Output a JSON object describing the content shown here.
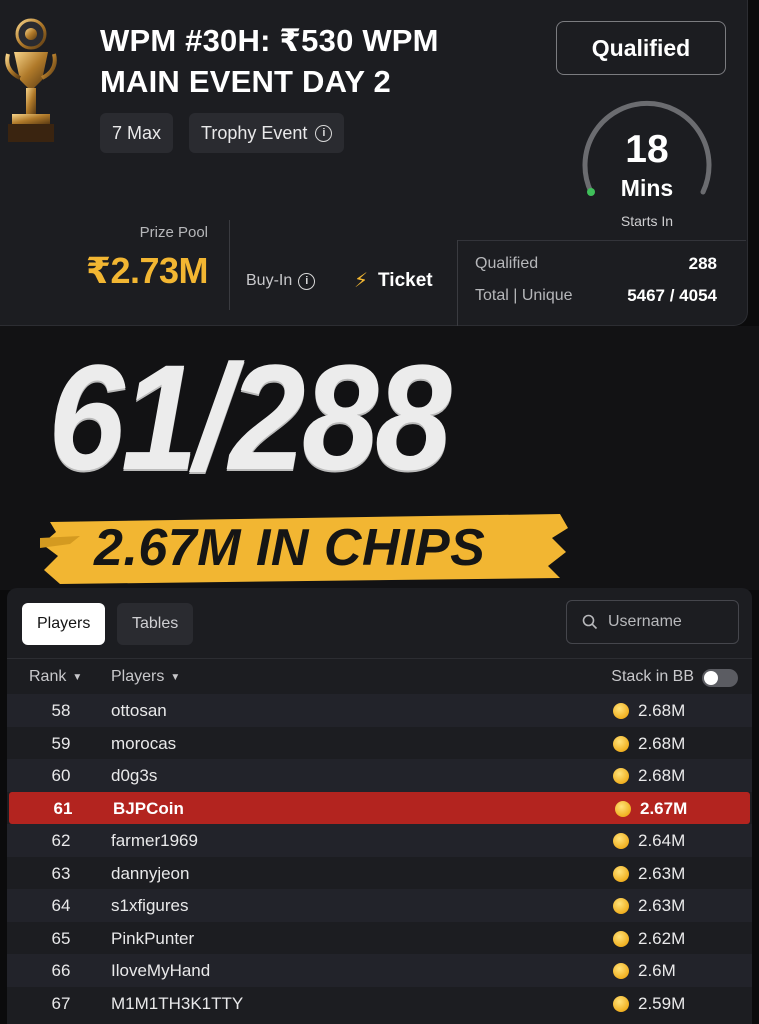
{
  "header": {
    "title_line1": "WPM #30H: ₹530 WPM",
    "title_line2": "MAIN EVENT DAY 2",
    "tags": [
      "7 Max",
      "Trophy Event"
    ],
    "status_button": "Qualified",
    "timer": {
      "value": "18",
      "unit": "Mins",
      "label": "Starts In"
    },
    "prize_pool_label": "Prize Pool",
    "prize_pool_value": "₹2.73M",
    "buyin_label": "Buy-In",
    "buyin_value": "Ticket",
    "stats": [
      {
        "label": "Qualified",
        "value": "288"
      },
      {
        "label": "Total | Unique",
        "value": "5467 / 4054"
      }
    ]
  },
  "overlay": {
    "rank_text": "61/288",
    "chips_text": "2.67M IN CHIPS"
  },
  "leaderboard": {
    "tabs": [
      "Players",
      "Tables"
    ],
    "search_placeholder": "Username",
    "columns": {
      "rank": "Rank",
      "players": "Players",
      "stack": "Stack in BB"
    },
    "rows": [
      {
        "rank": "58",
        "name": "ottosan",
        "stack": "2.68M"
      },
      {
        "rank": "59",
        "name": "morocas",
        "stack": "2.68M"
      },
      {
        "rank": "60",
        "name": "d0g3s",
        "stack": "2.68M"
      },
      {
        "rank": "61",
        "name": "BJPCoin",
        "stack": "2.67M"
      },
      {
        "rank": "62",
        "name": "farmer1969",
        "stack": "2.64M"
      },
      {
        "rank": "63",
        "name": "dannyjeon",
        "stack": "2.63M"
      },
      {
        "rank": "64",
        "name": "s1xfigures",
        "stack": "2.63M"
      },
      {
        "rank": "65",
        "name": "PinkPunter",
        "stack": "2.62M"
      },
      {
        "rank": "66",
        "name": "IloveMyHand",
        "stack": "2.6M"
      },
      {
        "rank": "67",
        "name": "M1M1TH3K1TTY",
        "stack": "2.59M"
      }
    ]
  },
  "colors": {
    "accent_gold": "#f2b632",
    "highlight_red": "#b3241f",
    "panel_bg": "#1c1d21"
  }
}
